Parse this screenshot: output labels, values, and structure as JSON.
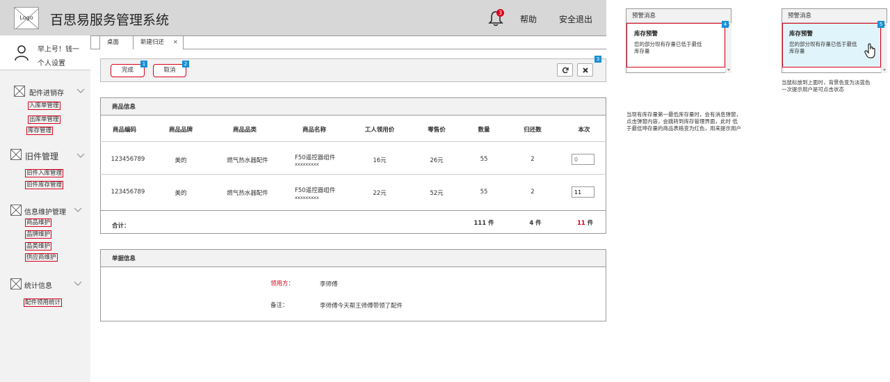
{
  "header": {
    "logo_text": "Logo",
    "app_title": "百思易服务管理系统",
    "notification_count": "3",
    "help": "帮助",
    "logout": "安全退出"
  },
  "user": {
    "greeting": "早上号！钱一",
    "settings": "个人设置"
  },
  "sidebar": {
    "groups": [
      {
        "title": "配件进销存",
        "items": [
          "入库单管理",
          "出库单管理",
          "库存管理"
        ]
      },
      {
        "title": "旧件管理",
        "items": [
          "旧件入库管理",
          "旧件库存管理"
        ]
      },
      {
        "title": "信息维护管理",
        "items": [
          "商品维护",
          "品牌维护",
          "品类维护",
          "供应商维护"
        ]
      },
      {
        "title": "统计信息",
        "items": [
          "配件领用统计"
        ]
      }
    ]
  },
  "tabs": [
    {
      "label": "桌面"
    },
    {
      "label": "新建归还",
      "close": "✕"
    }
  ],
  "toolbar": {
    "done_label": "完成",
    "done_num": "1",
    "cancel_label": "取消",
    "cancel_num": "2",
    "refresh_icon": "refresh-icon",
    "close_icon": "close-icon",
    "right_num": "3"
  },
  "product_panel": {
    "title": "商品信息",
    "columns": [
      "商品编码",
      "商品品牌",
      "商品品类",
      "商品名称",
      "工人领用价",
      "零售价",
      "数量",
      "归还数",
      "本次"
    ],
    "rows": [
      {
        "code": "123456789",
        "brand": "美的",
        "category": "燃气热水器配件",
        "name": "F50遥控器组件",
        "name_sub": "xxxxxxxxx",
        "worker_price": "16元",
        "retail_price": "26元",
        "qty": "55",
        "returned": "2",
        "current_placeholder": "0",
        "current": ""
      },
      {
        "code": "123456789",
        "brand": "美的",
        "category": "燃气热水器配件",
        "name": "F50遥控器组件",
        "name_sub": "xxxxxxxxx",
        "worker_price": "22元",
        "retail_price": "52元",
        "qty": "55",
        "returned": "2",
        "current_placeholder": "",
        "current": "11"
      }
    ],
    "total": {
      "label": "合计：",
      "qty": "111 件",
      "returned": "4 件",
      "current_value": "11",
      "current_unit": " 件"
    }
  },
  "order_panel": {
    "title": "单据信息",
    "receiver_label": "领用方：",
    "receiver_value": "李师傅",
    "remark_label": "备注：",
    "remark_value": "李师傅今天帮王师傅带领了配件"
  },
  "popups": [
    {
      "header": "预警消息",
      "title": "库存预警",
      "text_line1": "您的部分现有存量已低于最低",
      "text_line2": "库存量",
      "num": "4"
    },
    {
      "header": "预警消息",
      "title": "库存预警",
      "text_line1": "您的部分现有存量已低于最低",
      "text_line2": "库存量",
      "num": "5"
    }
  ],
  "notes": {
    "hover_line1": "当鼠标放到上面时，背景色变为淡蓝色",
    "hover_line2": "一次提示用户是可点击状态",
    "desc_line1": "当现有库存量第一最低库存量时，会有消息弹窗，",
    "desc_line2": "点击弹窗内容，会跳转到库存管理界面，此时 低",
    "desc_line3": "于最低坤存量的商品表格变为红色，用来提示用户"
  },
  "colors": {
    "accent_red": "#d9001b",
    "marker_blue": "#1890d4",
    "hover_bg": "#e0f4fb"
  }
}
